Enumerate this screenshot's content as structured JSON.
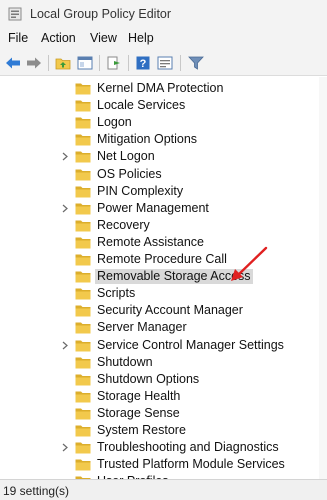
{
  "window": {
    "title": "Local Group Policy Editor",
    "app_icon": "policy-editor-icon"
  },
  "menu": [
    "File",
    "Action",
    "View",
    "Help"
  ],
  "toolbar": {
    "buttons": [
      "back-arrow-icon",
      "forward-arrow-icon",
      "up-folder-icon",
      "show-hide-tree-icon",
      "export-list-icon",
      "help-icon",
      "properties-icon",
      "filter-icon"
    ]
  },
  "tree": {
    "items": [
      {
        "label": "Kernel DMA Protection",
        "expandable": false
      },
      {
        "label": "Locale Services",
        "expandable": false
      },
      {
        "label": "Logon",
        "expandable": false
      },
      {
        "label": "Mitigation Options",
        "expandable": false
      },
      {
        "label": "Net Logon",
        "expandable": true
      },
      {
        "label": "OS Policies",
        "expandable": false
      },
      {
        "label": "PIN Complexity",
        "expandable": false
      },
      {
        "label": "Power Management",
        "expandable": true
      },
      {
        "label": "Recovery",
        "expandable": false
      },
      {
        "label": "Remote Assistance",
        "expandable": false
      },
      {
        "label": "Remote Procedure Call",
        "expandable": false
      },
      {
        "label": "Removable Storage Access",
        "expandable": false,
        "selected": true
      },
      {
        "label": "Scripts",
        "expandable": false
      },
      {
        "label": "Security Account Manager",
        "expandable": false
      },
      {
        "label": "Server Manager",
        "expandable": false
      },
      {
        "label": "Service Control Manager Settings",
        "expandable": true
      },
      {
        "label": "Shutdown",
        "expandable": false
      },
      {
        "label": "Shutdown Options",
        "expandable": false
      },
      {
        "label": "Storage Health",
        "expandable": false
      },
      {
        "label": "Storage Sense",
        "expandable": false
      },
      {
        "label": "System Restore",
        "expandable": false
      },
      {
        "label": "Troubleshooting and Diagnostics",
        "expandable": true
      },
      {
        "label": "Trusted Platform Module Services",
        "expandable": false
      },
      {
        "label": "User Profiles",
        "expandable": false
      }
    ]
  },
  "annotation": {
    "type": "red-arrow-icon",
    "color": "#e02020"
  },
  "status": {
    "text": "19 setting(s)"
  },
  "colors": {
    "chrome": "#f3f3f3",
    "selection": "#d9d9d9",
    "folder": "#f2c94c",
    "folder_dark": "#dcae2c"
  }
}
